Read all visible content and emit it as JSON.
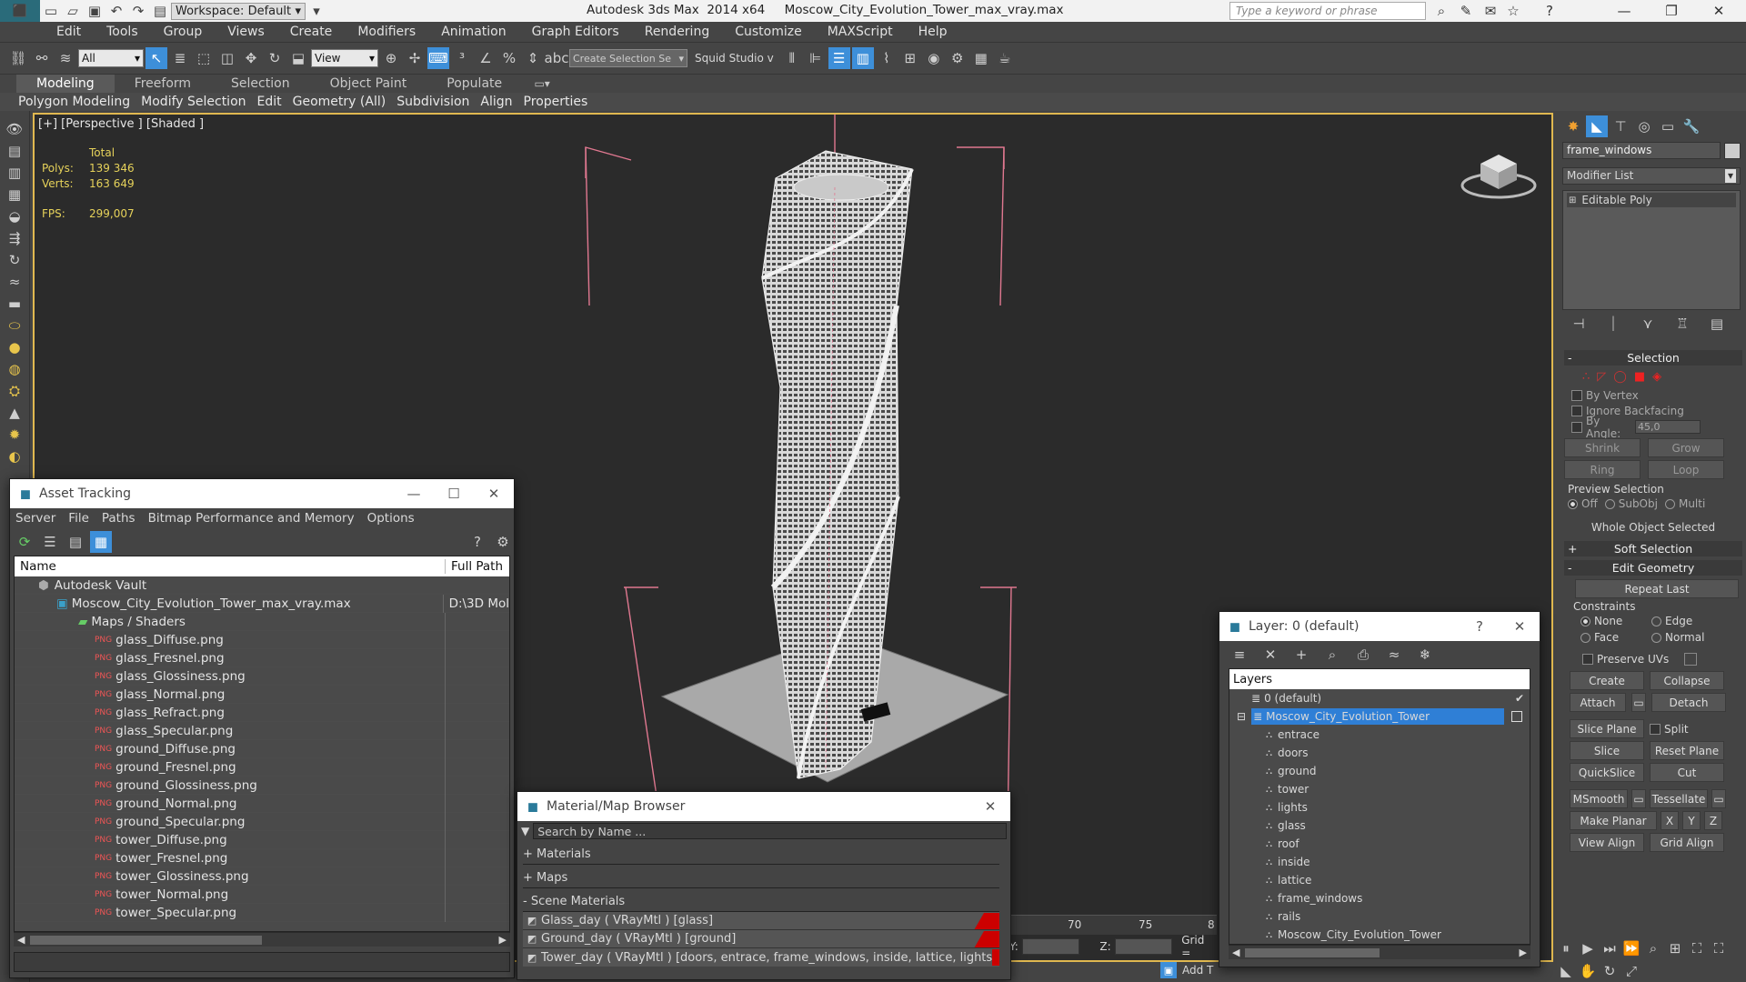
{
  "titlebar": {
    "workspace": "Workspace: Default",
    "title": "Autodesk 3ds Max  2014 x64     Moscow_City_Evolution_Tower_max_vray.max",
    "search_placeholder": "Type a keyword or phrase"
  },
  "menu": [
    "Edit",
    "Tools",
    "Group",
    "Views",
    "Create",
    "Modifiers",
    "Animation",
    "Graph Editors",
    "Rendering",
    "Customize",
    "MAXScript",
    "Help"
  ],
  "toolbar": {
    "filter": "All",
    "refcoord": "View",
    "selection_set": "Create Selection Se",
    "squid": "Squid Studio v"
  },
  "ribbon": {
    "tabs": [
      "Modeling",
      "Freeform",
      "Selection",
      "Object Paint",
      "Populate"
    ],
    "panel": [
      "Polygon Modeling",
      "Modify Selection",
      "Edit",
      "Geometry (All)",
      "Subdivision",
      "Align",
      "Properties"
    ]
  },
  "viewport": {
    "label": "[+] [Perspective ] [Shaded ]",
    "stats_total": "Total",
    "polys_label": "Polys:",
    "polys_value": "139 346",
    "verts_label": "Verts:",
    "verts_value": "163 649",
    "fps_label": "FPS:",
    "fps_value": "299,007"
  },
  "asset_tracking": {
    "title": "Asset Tracking",
    "menu": [
      "Server",
      "File",
      "Paths",
      "Bitmap Performance and Memory",
      "Options"
    ],
    "col_name": "Name",
    "col_path": "Full Path",
    "vault": "Autodesk Vault",
    "file": "Moscow_City_Evolution_Tower_max_vray.max",
    "file_path": "D:\\3D Mol",
    "maps_folder": "Maps / Shaders",
    "maps": [
      "glass_Diffuse.png",
      "glass_Fresnel.png",
      "glass_Glossiness.png",
      "glass_Normal.png",
      "glass_Refract.png",
      "glass_Specular.png",
      "ground_Diffuse.png",
      "ground_Fresnel.png",
      "ground_Glossiness.png",
      "ground_Normal.png",
      "ground_Specular.png",
      "tower_Diffuse.png",
      "tower_Fresnel.png",
      "tower_Glossiness.png",
      "tower_Normal.png",
      "tower_Specular.png"
    ]
  },
  "material_browser": {
    "title": "Material/Map Browser",
    "search_placeholder": "Search by Name ...",
    "materials": "+ Materials",
    "maps": "+ Maps",
    "scene_materials": "- Scene Materials",
    "items": [
      "Glass_day  ( VRayMtl ) [glass]",
      "Ground_day  ( VRayMtl ) [ground]",
      "Tower_day  ( VRayMtl ) [doors, entrace, frame_windows, inside, lattice, lights, r..."
    ]
  },
  "layer_window": {
    "title": "Layer: 0 (default)",
    "header": "Layers",
    "default_layer": "0 (default)",
    "active_layer": "Moscow_City_Evolution_Tower",
    "children": [
      "entrace",
      "doors",
      "ground",
      "tower",
      "lights",
      "glass",
      "roof",
      "inside",
      "lattice",
      "frame_windows",
      "rails",
      "Moscow_City_Evolution_Tower"
    ]
  },
  "timeline": {
    "ticks": [
      "70",
      "75",
      "8"
    ],
    "y_label": "Y:",
    "z_label": "Z:",
    "grid": "Grid =",
    "add": "Add T"
  },
  "command_panel": {
    "object_name": "frame_windows",
    "modifier_list": "Modifier List",
    "stack_item": "Editable Poly",
    "selection_header": "Selection",
    "by_vertex": "By Vertex",
    "ignore_backfacing": "Ignore Backfacing",
    "by_angle": "By Angle:",
    "angle_value": "45,0",
    "shrink": "Shrink",
    "grow": "Grow",
    "ring": "Ring",
    "loop": "Loop",
    "preview_selection": "Preview Selection",
    "off": "Off",
    "subobj": "SubObj",
    "multi": "Multi",
    "whole_object": "Whole Object Selected",
    "soft_selection": "Soft Selection",
    "edit_geometry": "Edit Geometry",
    "repeat_last": "Repeat Last",
    "constraints": "Constraints",
    "none": "None",
    "edge": "Edge",
    "face": "Face",
    "normal": "Normal",
    "preserve_uvs": "Preserve UVs",
    "create": "Create",
    "collapse": "Collapse",
    "attach": "Attach",
    "detach": "Detach",
    "slice_plane": "Slice Plane",
    "split": "Split",
    "slice": "Slice",
    "reset_plane": "Reset Plane",
    "quickslice": "QuickSlice",
    "cut": "Cut",
    "msmooth": "MSmooth",
    "tessellate": "Tessellate",
    "make_planar": "Make Planar",
    "x": "X",
    "y": "Y",
    "z": "Z",
    "view_align": "View Align",
    "grid_align": "Grid Align"
  },
  "colors": {
    "accent": "#3d8fd9",
    "viewport_border": "#e0b850",
    "stats": "#e6d25a",
    "selected": "#2f7fd6"
  }
}
